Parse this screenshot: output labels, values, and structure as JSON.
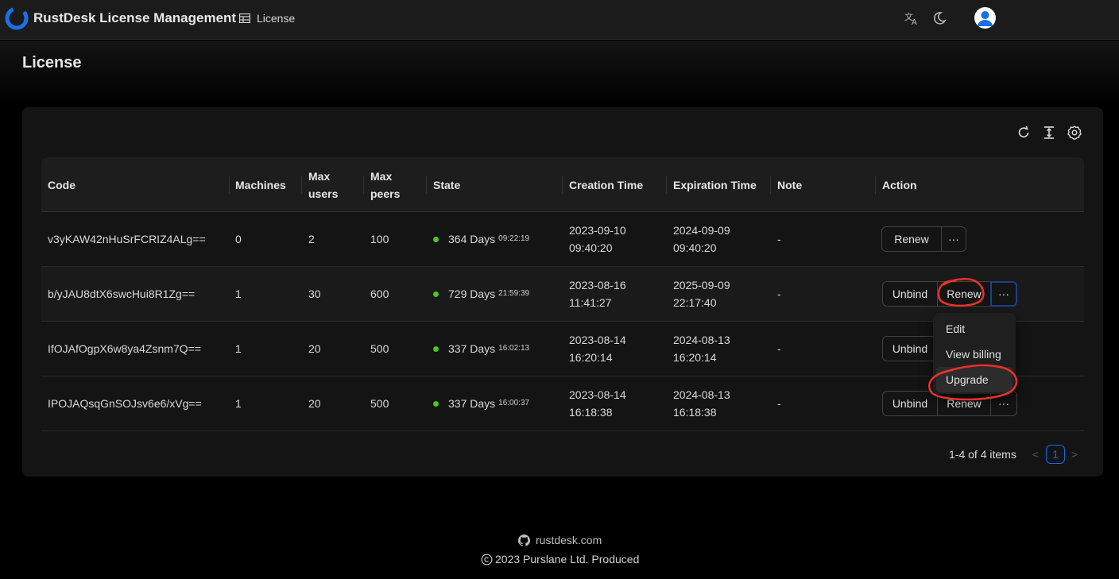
{
  "header": {
    "app_title": "RustDesk License Management",
    "nav_license": "License",
    "icons": [
      "translate-icon",
      "moon-icon",
      "user-avatar-icon"
    ]
  },
  "page": {
    "title": "License"
  },
  "toolbar": {
    "icons": [
      "reload-icon",
      "column-height-icon",
      "setting-icon"
    ]
  },
  "table": {
    "columns": [
      "Code",
      "Machines",
      "Max users",
      "Max peers",
      "State",
      "Creation Time",
      "Expiration Time",
      "Note",
      "Action"
    ],
    "col_max_users": [
      "Max",
      "users"
    ],
    "col_max_peers": [
      "Max",
      "peers"
    ],
    "rows": [
      {
        "code": "v3yKAW42nHuSrFCRIZ4ALg==",
        "machines": "0",
        "max_users": "2",
        "max_peers": "100",
        "state_days": "364 Days",
        "state_time": "09:22:19",
        "created_date": "2023-09-10",
        "created_time": "09:40:20",
        "expires_date": "2024-09-09",
        "expires_time": "09:40:20",
        "note": "-",
        "actions": [
          "Renew",
          "···"
        ]
      },
      {
        "code": "b/yJAU8dtX6swcHui8R1Zg==",
        "machines": "1",
        "max_users": "30",
        "max_peers": "600",
        "state_days": "729 Days",
        "state_time": "21:59:39",
        "created_date": "2023-08-16",
        "created_time": "11:41:27",
        "expires_date": "2025-09-09",
        "expires_time": "22:17:40",
        "note": "-",
        "actions": [
          "Unbind",
          "Renew",
          "···"
        ]
      },
      {
        "code": "IfOJAfOgpX6w8ya4Zsnm7Q==",
        "machines": "1",
        "max_users": "20",
        "max_peers": "500",
        "state_days": "337 Days",
        "state_time": "16:02:13",
        "created_date": "2023-08-14",
        "created_time": "16:20:14",
        "expires_date": "2024-08-13",
        "expires_time": "16:20:14",
        "note": "-",
        "actions": [
          "Unbind"
        ]
      },
      {
        "code": "IPOJAQsqGnSOJsv6e6/xVg==",
        "machines": "1",
        "max_users": "20",
        "max_peers": "500",
        "state_days": "337 Days",
        "state_time": "16:00:37",
        "created_date": "2023-08-14",
        "created_time": "16:18:38",
        "expires_date": "2024-08-13",
        "expires_time": "16:18:38",
        "note": "-",
        "actions": [
          "Unbind",
          "Renew",
          "···"
        ]
      }
    ]
  },
  "dropdown": {
    "items": [
      "Edit",
      "View billing",
      "Upgrade"
    ],
    "active": "Upgrade"
  },
  "pagination": {
    "total_text": "1-4 of 4 items",
    "current_page": "1",
    "prev": "<",
    "next": ">"
  },
  "footer": {
    "link_text": "rustdesk.com",
    "copyright": "2023 Purslane Ltd. Produced"
  },
  "colors": {
    "status_ok": "#52c41a",
    "primary": "#1668dc",
    "annotation": "#e8322a"
  }
}
